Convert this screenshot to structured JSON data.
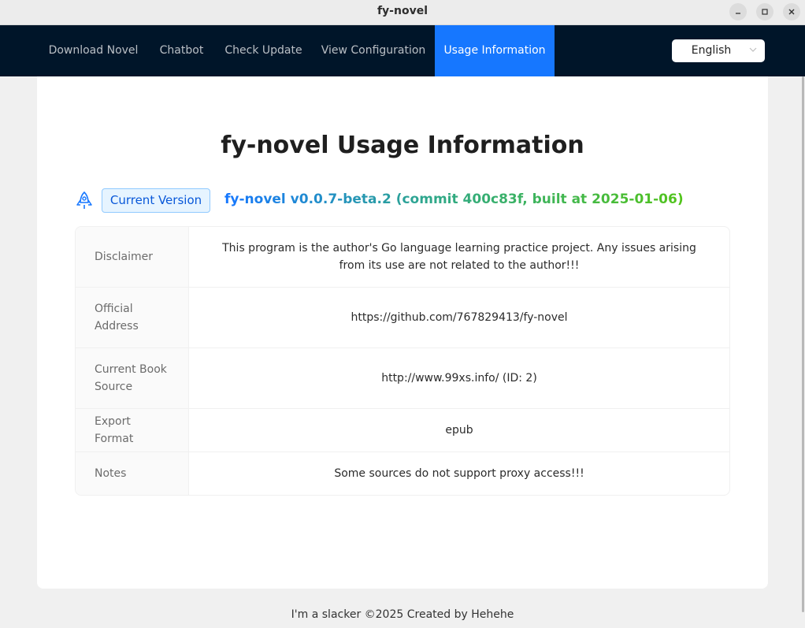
{
  "window": {
    "title": "fy-novel",
    "minimize_icon": "minimize-icon",
    "maximize_icon": "maximize-icon",
    "close_icon": "close-icon"
  },
  "nav": {
    "items": [
      {
        "label": "Download Novel"
      },
      {
        "label": "Chatbot"
      },
      {
        "label": "Check Update"
      },
      {
        "label": "View Configuration"
      },
      {
        "label": "Usage Information",
        "active": true
      }
    ],
    "language": {
      "selected": "English"
    },
    "active_color": "#1677ff",
    "background_color": "#001529"
  },
  "main": {
    "title": "fy-novel Usage Information",
    "version_icon": "rocket-icon",
    "version_tag": "Current Version",
    "version_text": "fy-novel v0.0.7-beta.2 (commit 400c83f, built at 2025-01-06)",
    "rows": [
      {
        "label": "Disclaimer",
        "value": "This program is the author's Go language learning practice project. Any issues arising from its use are not related to the author!!!"
      },
      {
        "label": "Official Address",
        "value": "https://github.com/767829413/fy-novel"
      },
      {
        "label": "Current Book Source",
        "value": "http://www.99xs.info/ (ID: 2)"
      },
      {
        "label": "Export Format",
        "value": "epub"
      },
      {
        "label": "Notes",
        "value": "Some sources do not support proxy access!!!"
      }
    ]
  },
  "footer": {
    "text": "I'm a slacker ©2025 Created by Hehehe"
  }
}
